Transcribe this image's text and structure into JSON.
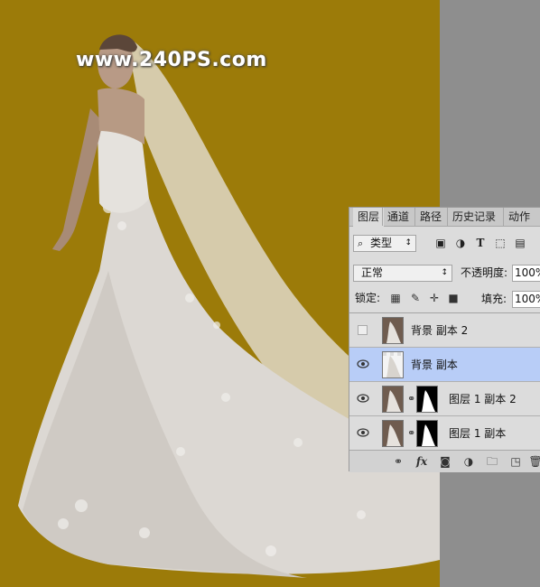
{
  "watermark": "www.240PS.com",
  "colors": {
    "canvas_bg": "#9c7b09",
    "pasteboard": "#8e8e8e",
    "selected_layer": "#b8cdf7"
  },
  "layers_panel": {
    "tabs": [
      "图层",
      "通道",
      "路径",
      "历史记录",
      "动作"
    ],
    "active_tab": "图层",
    "filter": {
      "label": "类型",
      "icons": [
        "image-filter-icon",
        "adjustment-filter-icon",
        "type-filter-icon",
        "shape-filter-icon",
        "smart-object-filter-icon"
      ]
    },
    "blend_mode": "正常",
    "opacity_label": "不透明度:",
    "opacity_value": "100%",
    "lock_label": "锁定:",
    "fill_label": "填充:",
    "fill_value": "100%",
    "layers": [
      {
        "name": "背景 副本 2",
        "visible": false,
        "selected": false,
        "has_mask": false
      },
      {
        "name": "背景 副本",
        "visible": true,
        "selected": true,
        "has_mask": false
      },
      {
        "name": "图层 1 副本 2",
        "visible": true,
        "selected": false,
        "has_mask": true
      },
      {
        "name": "图层 1 副本",
        "visible": true,
        "selected": false,
        "has_mask": true
      }
    ],
    "bottom_icons": [
      "link-layers-icon",
      "fx-icon",
      "add-mask-icon",
      "adjustment-layer-icon",
      "new-group-icon",
      "new-layer-icon",
      "delete-icon"
    ],
    "fx_label": "fx"
  }
}
